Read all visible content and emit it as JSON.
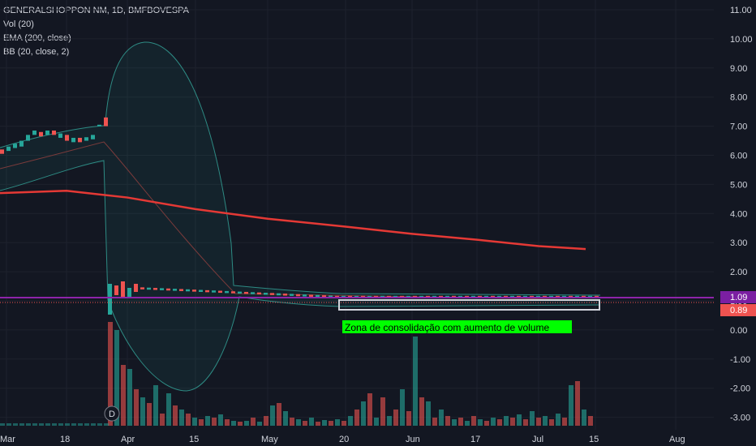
{
  "legend": {
    "symbol": "GENERALSHOPPON NM, 1D, BMFBOVESPA",
    "vol": "Vol (20)",
    "ema": "EMA (200, close)",
    "bb": "BB (20, close, 2)"
  },
  "price_tags": {
    "upper": {
      "label": "1.09",
      "color": "#7b1fa2"
    },
    "lower": {
      "label": "0.89",
      "color": "#ef5350"
    }
  },
  "annotation": {
    "text": "Zona de consolidação com aumento de volume",
    "color": "#00ff00"
  },
  "event_marker": {
    "label": "D"
  },
  "colors": {
    "background": "#131722",
    "up": "#26a69a",
    "down": "#ef5350",
    "ema": "#e53935",
    "bb_line": "#2e8b84",
    "rectangle": "#d1d4dc",
    "hline": "#8e24aa"
  },
  "chart_data": {
    "type": "candlestick",
    "scale": "log",
    "y_ticks": [
      "11.00",
      "10.00",
      "9.00",
      "8.00",
      "7.00",
      "6.00",
      "5.00",
      "4.00",
      "3.00",
      "2.00",
      "1.00",
      "0.00",
      "-1.00",
      "-2.00",
      "-3.00"
    ],
    "x_ticks": [
      "Mar",
      "18",
      "Apr",
      "15",
      "May",
      "20",
      "Jun",
      "17",
      "Jul",
      "15",
      "Aug"
    ],
    "series": [
      {
        "name": "EMA (200, close)",
        "x": [
          "Mar",
          "18",
          "Apr",
          "15",
          "May",
          "20",
          "Jun",
          "17",
          "Jul",
          "15"
        ],
        "values": [
          4.7,
          4.78,
          4.55,
          4.15,
          3.82,
          3.55,
          3.3,
          3.1,
          2.88,
          2.78
        ]
      },
      {
        "name": "BB (20, close, 2)",
        "x": [
          "Mar",
          "18",
          "Apr",
          "15",
          "May",
          "20",
          "Jun",
          "17",
          "Jul",
          "15"
        ],
        "upper": [
          7.0,
          7.1,
          9.8,
          1.4,
          1.2,
          1.05,
          1.05,
          1.05,
          1.05,
          1.05
        ],
        "lower": [
          4.8,
          4.8,
          -2.0,
          1.0,
          0.9,
          0.85,
          0.85,
          0.85,
          0.85,
          0.85
        ]
      }
    ],
    "last_price": 0.89,
    "horizontal_line": 1.09
  }
}
